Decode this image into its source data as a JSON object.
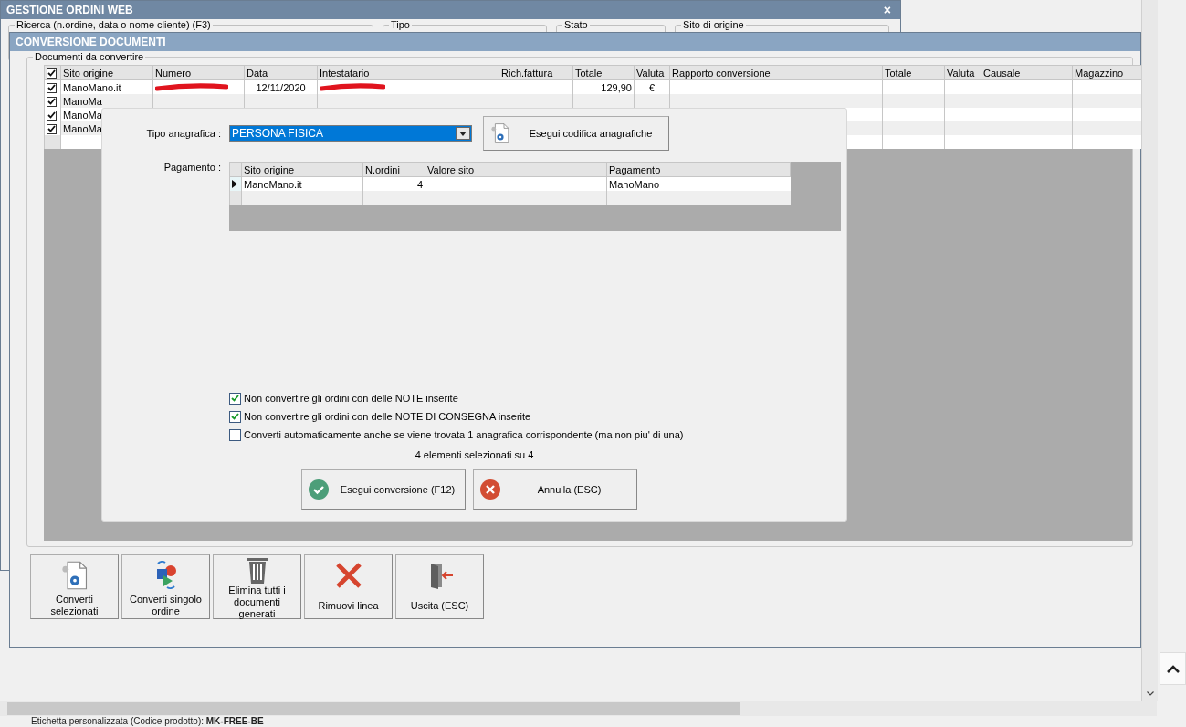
{
  "back_window": {
    "title": "GESTIONE ORDINI WEB",
    "close": "×",
    "filters": [
      {
        "label": "Ricerca (n.ordine, data o nome cliente) (F3)"
      },
      {
        "label": "Tipo"
      },
      {
        "label": "Stato"
      },
      {
        "label": "Sito di origine"
      }
    ]
  },
  "window": {
    "title": "CONVERSIONE DOCUMENTI"
  },
  "documents": {
    "legend": "Documenti da convertire",
    "all_checked": true,
    "columns": [
      "Sito origine",
      "Numero",
      "Data",
      "Intestatario",
      "Rich.fattura",
      "Totale",
      "Valuta",
      "Rapporto conversione",
      "Totale",
      "Valuta",
      "Causale",
      "Magazzino"
    ],
    "rows": [
      {
        "checked": true,
        "site": "ManoMano.it",
        "number_redacted": true,
        "date": "12/11/2020",
        "holder_redacted": true,
        "total": "129,90",
        "currency": "€"
      },
      {
        "checked": true,
        "site": "ManoMa"
      },
      {
        "checked": true,
        "site": "ManoMa"
      },
      {
        "checked": true,
        "site": "ManoMa"
      }
    ]
  },
  "dialog": {
    "tipo_label": "Tipo anagrafica :",
    "tipo_value": "PERSONA FISICA",
    "codifica_button": "Esegui codifica anagrafiche",
    "payment_label": "Pagamento :",
    "payment_columns": [
      "Sito origine",
      "N.ordini",
      "Valore sito",
      "Pagamento"
    ],
    "payment_rows": [
      {
        "selected": true,
        "site": "ManoMano.it",
        "orders": "4",
        "payment": "ManoMano"
      }
    ],
    "options": [
      {
        "label": "Non convertire gli ordini con delle NOTE inserite",
        "checked": true
      },
      {
        "label": "Non convertire gli ordini con delle NOTE DI CONSEGNA inserite",
        "checked": true
      },
      {
        "label": "Converti automaticamente anche se viene trovata 1 anagrafica corrispondente (ma non piu' di una)",
        "checked": false
      }
    ],
    "selection_count": "4 elementi selezionati su 4",
    "buttons": [
      {
        "kind": "confirm",
        "label": "Esegui conversione (F12)"
      },
      {
        "kind": "cancel",
        "label": "Annulla (ESC)"
      }
    ]
  },
  "toolbar": [
    {
      "kind": "convert",
      "label": "Converti selezionati"
    },
    {
      "kind": "convert_single",
      "label": "Converti singolo ordine"
    },
    {
      "kind": "delete_all",
      "label": "Elimina tutti i documenti generati"
    },
    {
      "kind": "remove",
      "label": "Rimuovi linea"
    },
    {
      "kind": "exit",
      "label": "Uscita (ESC)"
    }
  ],
  "footer": {
    "label": "Etichetta personalizzata (Codice prodotto):",
    "value": "MK-FREE-BE"
  }
}
